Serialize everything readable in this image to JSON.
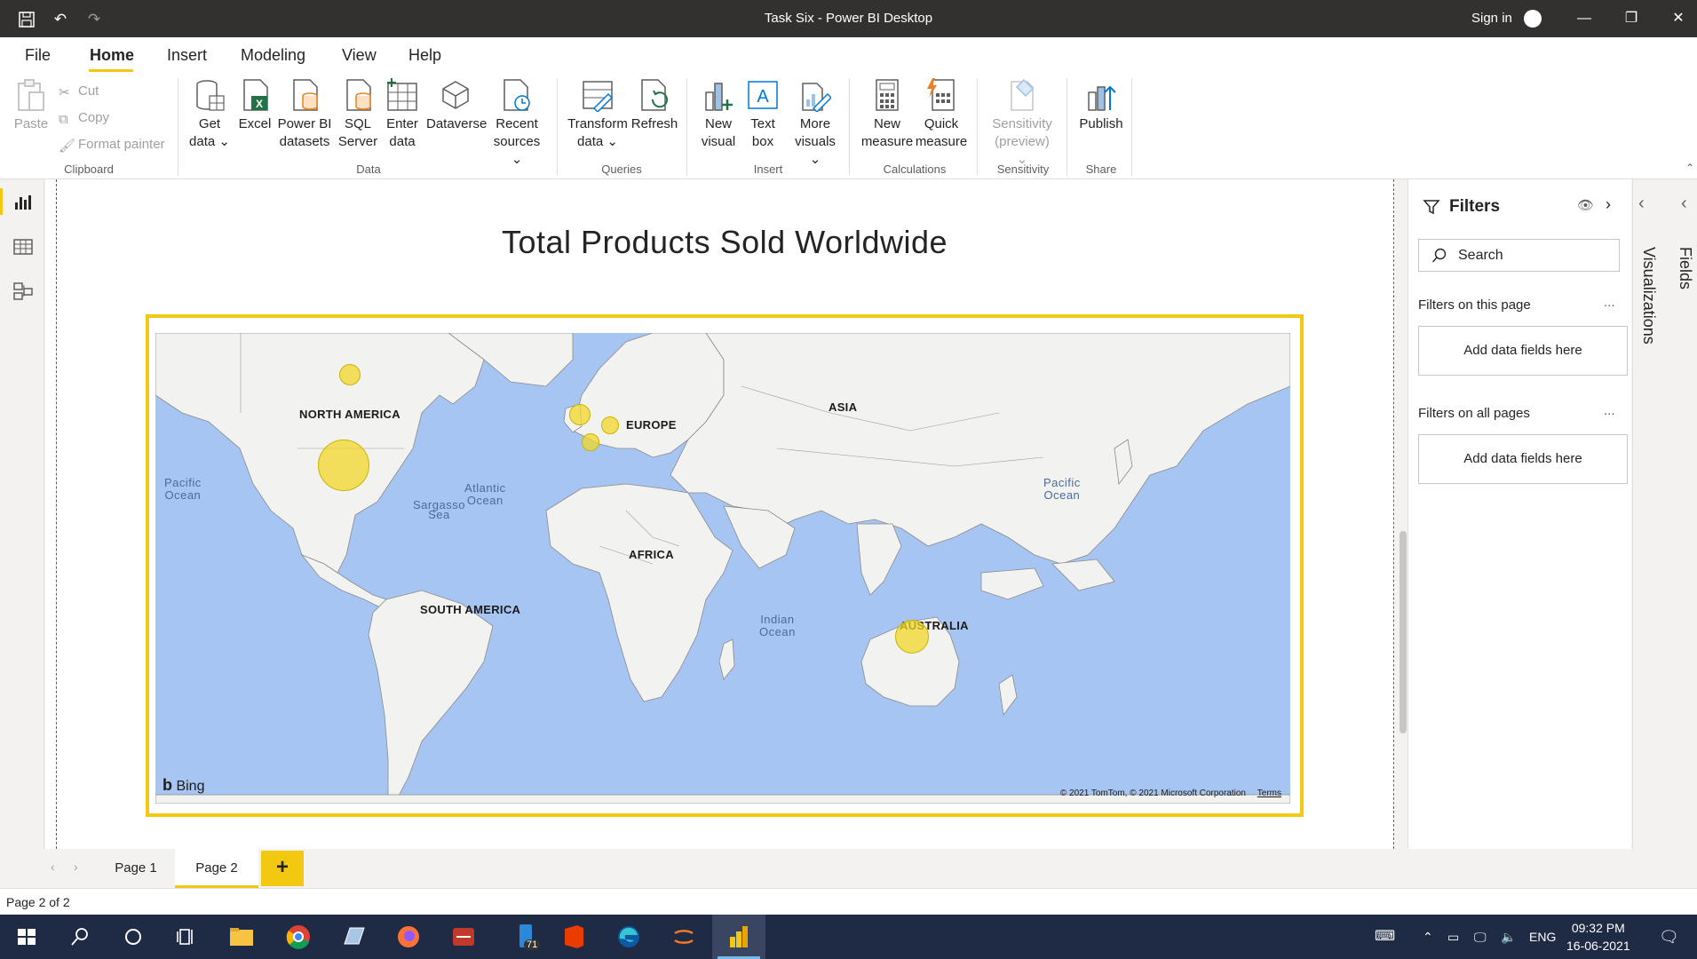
{
  "window": {
    "title": "Task Six - Power BI Desktop",
    "signin_label": "Sign in"
  },
  "menu": {
    "tabs": [
      {
        "label": "File"
      },
      {
        "label": "Home"
      },
      {
        "label": "Insert"
      },
      {
        "label": "Modeling"
      },
      {
        "label": "View"
      },
      {
        "label": "Help"
      }
    ],
    "active_tab": "Home"
  },
  "ribbon": {
    "clipboard": {
      "paste": "Paste",
      "cut": "Cut",
      "copy": "Copy",
      "format_painter": "Format painter",
      "group": "Clipboard"
    },
    "data": {
      "get_data_1": "Get",
      "get_data_2": "data",
      "excel": "Excel",
      "pbi_datasets_1": "Power BI",
      "pbi_datasets_2": "datasets",
      "sql_1": "SQL",
      "sql_2": "Server",
      "enter_1": "Enter",
      "enter_2": "data",
      "dataverse": "Dataverse",
      "recent_1": "Recent",
      "recent_2": "sources",
      "group": "Data"
    },
    "queries": {
      "transform_1": "Transform",
      "transform_2": "data",
      "refresh": "Refresh",
      "group": "Queries"
    },
    "insert": {
      "new_visual_1": "New",
      "new_visual_2": "visual",
      "text_box_1": "Text",
      "text_box_2": "box",
      "more_1": "More",
      "more_2": "visuals",
      "group": "Insert"
    },
    "calculations": {
      "new_measure_1": "New",
      "new_measure_2": "measure",
      "quick_measure_1": "Quick",
      "quick_measure_2": "measure",
      "group": "Calculations"
    },
    "sensitivity": {
      "label_1": "Sensitivity",
      "label_2": "(preview)",
      "group": "Sensitivity"
    },
    "share": {
      "publish": "Publish",
      "group": "Share"
    }
  },
  "report": {
    "title": "Total Products Sold Worldwide",
    "map": {
      "continents": [
        "NORTH AMERICA",
        "EUROPE",
        "ASIA",
        "AFRICA",
        "SOUTH AMERICA",
        "AUSTRALIA"
      ],
      "oceans": {
        "pacific_w_1": "Pacific",
        "pacific_w_2": "Ocean",
        "atlantic_1": "Atlantic",
        "atlantic_2": "Ocean",
        "sargasso_1": "Sargasso",
        "sargasso_2": "Sea",
        "indian_1": "Indian",
        "indian_2": "Ocean",
        "pacific_e_1": "Pacific",
        "pacific_e_2": "Ocean"
      },
      "provider": "Bing",
      "copyright": "© 2021 TomTom, © 2021 Microsoft Corporation",
      "terms": "Terms",
      "bubble_color": "#f2d728"
    }
  },
  "filters": {
    "title": "Filters",
    "search_placeholder": "Search",
    "on_this_page": "Filters on this page",
    "on_all_pages": "Filters on all pages",
    "well_label": "Add data fields here",
    "more": "..."
  },
  "side_tabs": {
    "visualizations": "Visualizations",
    "fields": "Fields"
  },
  "pages": {
    "tabs": [
      "Page 1",
      "Page 2"
    ],
    "active": "Page 2",
    "add": "+"
  },
  "status": {
    "page_indicator": "Page 2 of 2"
  },
  "taskbar": {
    "badge_count": "71",
    "language": "ENG",
    "time": "09:32 PM",
    "date": "16-06-2021"
  },
  "colors": {
    "accent": "#f2c811",
    "titlebar": "#323130",
    "taskbar": "#1f2a44",
    "map_water": "#a7c5f2"
  }
}
